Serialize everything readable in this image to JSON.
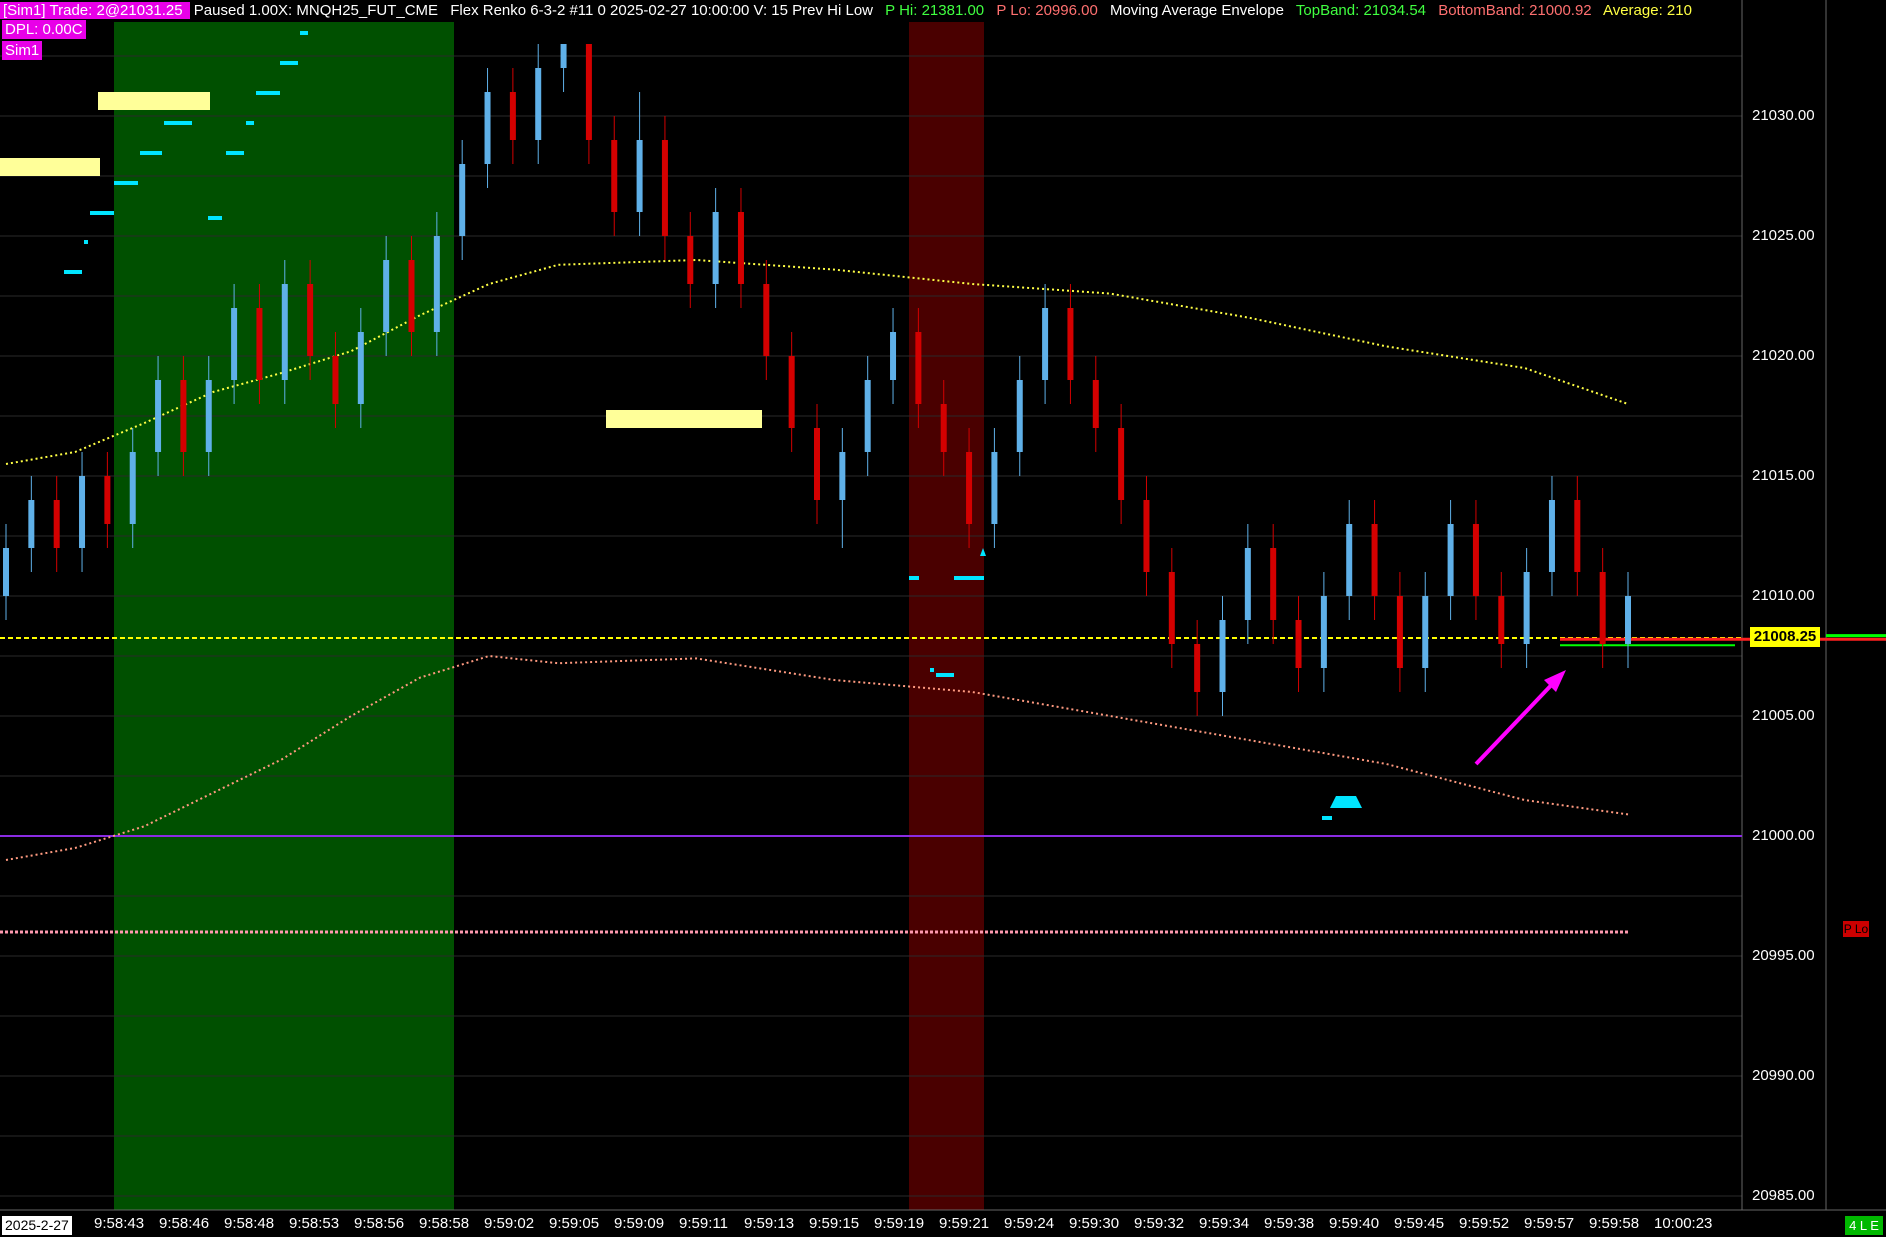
{
  "header": {
    "account_badge": "[Sim1]",
    "trade_badge": "Trade: 2@21031.25",
    "playback_status": "Paused 1.00X: MNQH25_FUT_CME",
    "chart_info": "Flex Renko 6-3-2 #11 0 2025-02-27 10:00:00 V: 15 Prev Hi Low",
    "p_hi": "P Hi: 21381.00",
    "p_lo": "P Lo: 20996.00",
    "indicator_name": "Moving Average Envelope",
    "top_band": "TopBand: 21034.54",
    "bottom_band": "BottomBand: 21000.92",
    "average": "Average: 210"
  },
  "badges": {
    "dpl": "DPL: 0.00C",
    "sim": "Sim1"
  },
  "price_axis": {
    "labels": [
      "21030.00",
      "21025.00",
      "21020.00",
      "21015.00",
      "21010.00",
      "21005.00",
      "21000.00",
      "20995.00",
      "20990.00",
      "20985.00"
    ],
    "current_price": "21008.25",
    "p_lo_tag": "P Lo"
  },
  "time_axis": {
    "date": "2025-2-27",
    "labels": [
      "9:58:43",
      "9:58:46",
      "9:58:48",
      "9:58:53",
      "9:58:56",
      "9:58:58",
      "9:59:02",
      "9:59:05",
      "9:59:09",
      "9:59:11",
      "9:59:13",
      "9:59:15",
      "9:59:19",
      "9:59:21",
      "9:59:24",
      "9:59:30",
      "9:59:32",
      "9:59:34",
      "9:59:38",
      "9:59:40",
      "9:59:45",
      "9:59:52",
      "9:59:57",
      "9:59:58",
      "10:00:23"
    ]
  },
  "footer": {
    "counter": "4 L E"
  },
  "colors": {
    "background": "#000000",
    "up_bar": "#5fb0e8",
    "down_bar": "#d40000",
    "green_zone": "#005000",
    "red_zone": "#4a0000",
    "envelope_top": "#ffff44",
    "envelope_bottom": "#ff9a80",
    "purple_line": "#8a2be2",
    "magenta_badge": "#e800e8",
    "arrow": "#ff00ff",
    "cyan_marker": "#00e5ff",
    "signal_block": "#ffff99"
  },
  "chart_data": {
    "type": "candlestick",
    "y_range": [
      20985,
      21033
    ],
    "levels": {
      "current": 21008.25,
      "round_number": 21000.0,
      "p_lo": 20996.0,
      "green_marker": 21008.0
    },
    "envelope_top": [
      [
        0,
        21015.5
      ],
      [
        10,
        21016.0
      ],
      [
        20,
        21017.2
      ],
      [
        30,
        21018.5
      ],
      [
        40,
        21019.3
      ],
      [
        50,
        21020.2
      ],
      [
        60,
        21021.7
      ],
      [
        70,
        21023.0
      ],
      [
        80,
        21023.8
      ],
      [
        100,
        21024.0
      ],
      [
        120,
        21023.6
      ],
      [
        140,
        21023.0
      ],
      [
        160,
        21022.6
      ],
      [
        180,
        21021.6
      ],
      [
        200,
        21020.4
      ],
      [
        220,
        21019.5
      ],
      [
        235,
        21018.0
      ]
    ],
    "envelope_bottom": [
      [
        0,
        20999.0
      ],
      [
        10,
        20999.5
      ],
      [
        20,
        21000.4
      ],
      [
        30,
        21001.8
      ],
      [
        40,
        21003.2
      ],
      [
        50,
        21005.0
      ],
      [
        60,
        21006.6
      ],
      [
        70,
        21007.5
      ],
      [
        80,
        21007.2
      ],
      [
        100,
        21007.4
      ],
      [
        120,
        21006.5
      ],
      [
        140,
        21006.0
      ],
      [
        160,
        21005.0
      ],
      [
        180,
        21004.0
      ],
      [
        200,
        21003.0
      ],
      [
        220,
        21001.5
      ],
      [
        235,
        21000.9
      ]
    ],
    "bars": [
      {
        "o": 21010,
        "c": 21012,
        "h": 21013,
        "l": 21009
      },
      {
        "o": 21012,
        "c": 21014,
        "h": 21015,
        "l": 21011
      },
      {
        "o": 21014,
        "c": 21012,
        "h": 21015,
        "l": 21011
      },
      {
        "o": 21012,
        "c": 21015,
        "h": 21016,
        "l": 21011
      },
      {
        "o": 21015,
        "c": 21013,
        "h": 21016,
        "l": 21012
      },
      {
        "o": 21013,
        "c": 21016,
        "h": 21017,
        "l": 21012
      },
      {
        "o": 21016,
        "c": 21019,
        "h": 21020,
        "l": 21015
      },
      {
        "o": 21019,
        "c": 21016,
        "h": 21020,
        "l": 21015
      },
      {
        "o": 21016,
        "c": 21019,
        "h": 21020,
        "l": 21015
      },
      {
        "o": 21019,
        "c": 21022,
        "h": 21023,
        "l": 21018
      },
      {
        "o": 21022,
        "c": 21019,
        "h": 21023,
        "l": 21018
      },
      {
        "o": 21019,
        "c": 21023,
        "h": 21024,
        "l": 21018
      },
      {
        "o": 21023,
        "c": 21020,
        "h": 21024,
        "l": 21019
      },
      {
        "o": 21020,
        "c": 21018,
        "h": 21021,
        "l": 21017
      },
      {
        "o": 21018,
        "c": 21021,
        "h": 21022,
        "l": 21017
      },
      {
        "o": 21021,
        "c": 21024,
        "h": 21025,
        "l": 21020
      },
      {
        "o": 21024,
        "c": 21021,
        "h": 21025,
        "l": 21020
      },
      {
        "o": 21021,
        "c": 21025,
        "h": 21026,
        "l": 21020
      },
      {
        "o": 21025,
        "c": 21028,
        "h": 21029,
        "l": 21024
      },
      {
        "o": 21028,
        "c": 21031,
        "h": 21032,
        "l": 21027
      },
      {
        "o": 21031,
        "c": 21029,
        "h": 21032,
        "l": 21028
      },
      {
        "o": 21029,
        "c": 21032,
        "h": 21033,
        "l": 21028
      },
      {
        "o": 21032,
        "c": 21033,
        "h": 21033,
        "l": 21031
      },
      {
        "o": 21033,
        "c": 21029,
        "h": 21033,
        "l": 21028
      },
      {
        "o": 21029,
        "c": 21026,
        "h": 21030,
        "l": 21025
      },
      {
        "o": 21026,
        "c": 21029,
        "h": 21031,
        "l": 21025
      },
      {
        "o": 21029,
        "c": 21025,
        "h": 21030,
        "l": 21024
      },
      {
        "o": 21025,
        "c": 21023,
        "h": 21026,
        "l": 21022
      },
      {
        "o": 21023,
        "c": 21026,
        "h": 21027,
        "l": 21022
      },
      {
        "o": 21026,
        "c": 21023,
        "h": 21027,
        "l": 21022
      },
      {
        "o": 21023,
        "c": 21020,
        "h": 21024,
        "l": 21019
      },
      {
        "o": 21020,
        "c": 21017,
        "h": 21021,
        "l": 21016
      },
      {
        "o": 21017,
        "c": 21014,
        "h": 21018,
        "l": 21013
      },
      {
        "o": 21014,
        "c": 21016,
        "h": 21017,
        "l": 21012
      },
      {
        "o": 21016,
        "c": 21019,
        "h": 21020,
        "l": 21015
      },
      {
        "o": 21019,
        "c": 21021,
        "h": 21022,
        "l": 21018
      },
      {
        "o": 21021,
        "c": 21018,
        "h": 21022,
        "l": 21017
      },
      {
        "o": 21018,
        "c": 21016,
        "h": 21019,
        "l": 21015
      },
      {
        "o": 21016,
        "c": 21013,
        "h": 21017,
        "l": 21012
      },
      {
        "o": 21013,
        "c": 21016,
        "h": 21017,
        "l": 21012
      },
      {
        "o": 21016,
        "c": 21019,
        "h": 21020,
        "l": 21015
      },
      {
        "o": 21019,
        "c": 21022,
        "h": 21023,
        "l": 21018
      },
      {
        "o": 21022,
        "c": 21019,
        "h": 21023,
        "l": 21018
      },
      {
        "o": 21019,
        "c": 21017,
        "h": 21020,
        "l": 21016
      },
      {
        "o": 21017,
        "c": 21014,
        "h": 21018,
        "l": 21013
      },
      {
        "o": 21014,
        "c": 21011,
        "h": 21015,
        "l": 21010
      },
      {
        "o": 21011,
        "c": 21008,
        "h": 21012,
        "l": 21007
      },
      {
        "o": 21008,
        "c": 21006,
        "h": 21009,
        "l": 21005
      },
      {
        "o": 21006,
        "c": 21009,
        "h": 21010,
        "l": 21005
      },
      {
        "o": 21009,
        "c": 21012,
        "h": 21013,
        "l": 21008
      },
      {
        "o": 21012,
        "c": 21009,
        "h": 21013,
        "l": 21008
      },
      {
        "o": 21009,
        "c": 21007,
        "h": 21010,
        "l": 21006
      },
      {
        "o": 21007,
        "c": 21010,
        "h": 21011,
        "l": 21006
      },
      {
        "o": 21010,
        "c": 21013,
        "h": 21014,
        "l": 21009
      },
      {
        "o": 21013,
        "c": 21010,
        "h": 21014,
        "l": 21009
      },
      {
        "o": 21010,
        "c": 21007,
        "h": 21011,
        "l": 21006
      },
      {
        "o": 21007,
        "c": 21010,
        "h": 21011,
        "l": 21006
      },
      {
        "o": 21010,
        "c": 21013,
        "h": 21014,
        "l": 21009
      },
      {
        "o": 21013,
        "c": 21010,
        "h": 21014,
        "l": 21009
      },
      {
        "o": 21010,
        "c": 21008,
        "h": 21011,
        "l": 21007
      },
      {
        "o": 21008,
        "c": 21011,
        "h": 21012,
        "l": 21007
      },
      {
        "o": 21011,
        "c": 21014,
        "h": 21015,
        "l": 21010
      },
      {
        "o": 21014,
        "c": 21011,
        "h": 21015,
        "l": 21010
      },
      {
        "o": 21011,
        "c": 21008,
        "h": 21012,
        "l": 21007
      },
      {
        "o": 21008,
        "c": 21010,
        "h": 21011,
        "l": 21007
      }
    ]
  }
}
